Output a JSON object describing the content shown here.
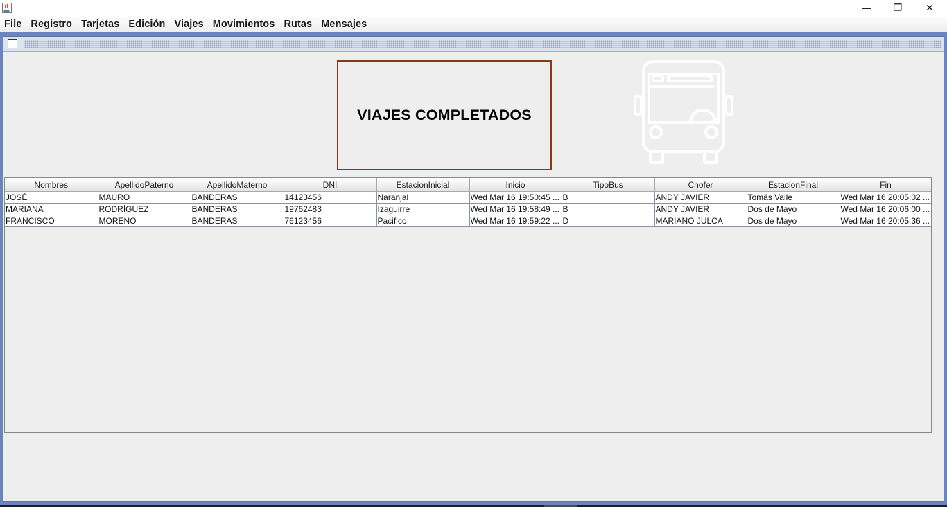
{
  "window": {
    "minimize_glyph": "—",
    "maximize_glyph": "❐",
    "close_glyph": "✕"
  },
  "menu": [
    "File",
    "Registro",
    "Tarjetas",
    "Edición",
    "Viajes",
    "Movimientos",
    "Rutas",
    "Mensajes"
  ],
  "panel": {
    "title": "VIAJES COMPLETADOS",
    "image_icon": "bus-icon"
  },
  "table": {
    "columns": [
      "Nombres",
      "ApellidoPaterno",
      "ApellidoMaterno",
      "DNI",
      "EstacionInicial",
      "Inicio",
      "TipoBus",
      "Chofer",
      "EstacionFinal",
      "Fin"
    ],
    "rows": [
      [
        "JOSÉ",
        "MAURO",
        "BANDERAS",
        "14123456",
        "Naranjal",
        "Wed Mar 16 19:50:45 ...",
        "B",
        "ANDY JAVIER",
        "Tomás Valle",
        "Wed Mar 16 20:05:02 ..."
      ],
      [
        "MARIANA",
        "RODRÍGUEZ",
        "BANDERAS",
        "19762483",
        "Izaguirre",
        "Wed Mar 16 19:58:49 ...",
        "B",
        "ANDY JAVIER",
        "Dos de Mayo",
        "Wed Mar 16 20:06:00 ..."
      ],
      [
        "FRANCISCO",
        "MORENO",
        "BANDERAS",
        "76123456",
        "Pacifico",
        "Wed Mar 16 19:59:22 ...",
        "D",
        "MARIANO JULCA",
        "Dos de Mayo",
        "Wed Mar 16 20:05:36 ..."
      ]
    ]
  },
  "colors": {
    "desktop": "#6b86be",
    "heading_border": "#8a3a10",
    "panel_bg": "#eeeeee"
  }
}
